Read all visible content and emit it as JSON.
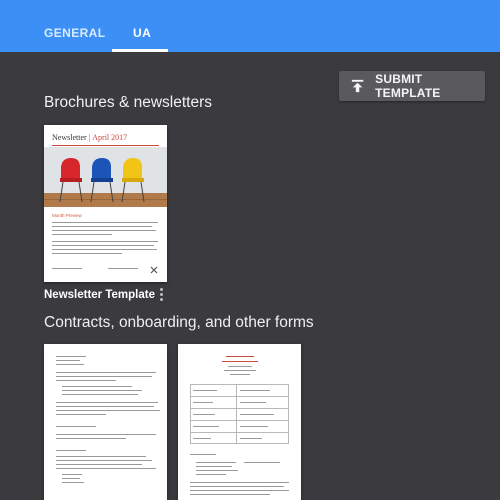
{
  "tabs": [
    {
      "label": "GENERAL",
      "selected": false
    },
    {
      "label": "UA",
      "selected": true
    }
  ],
  "toolbar": {
    "submit_label": "SUBMIT TEMPLATE",
    "submit_icon": "upload-icon"
  },
  "sections": [
    {
      "title": "Brochures & newsletters",
      "cards": [
        {
          "name": "Newsletter Template",
          "preview_title": "Newsletter",
          "preview_separator": "|",
          "preview_date": "April 2017",
          "preview_subhead": "Month Preview"
        }
      ]
    },
    {
      "title": "Contracts, onboarding, and other forms",
      "cards": []
    }
  ],
  "colors": {
    "topbar": "#3b8ff5",
    "background": "#3b3b3f",
    "button": "#5a5a5e",
    "accent_red": "#c84a3d"
  }
}
